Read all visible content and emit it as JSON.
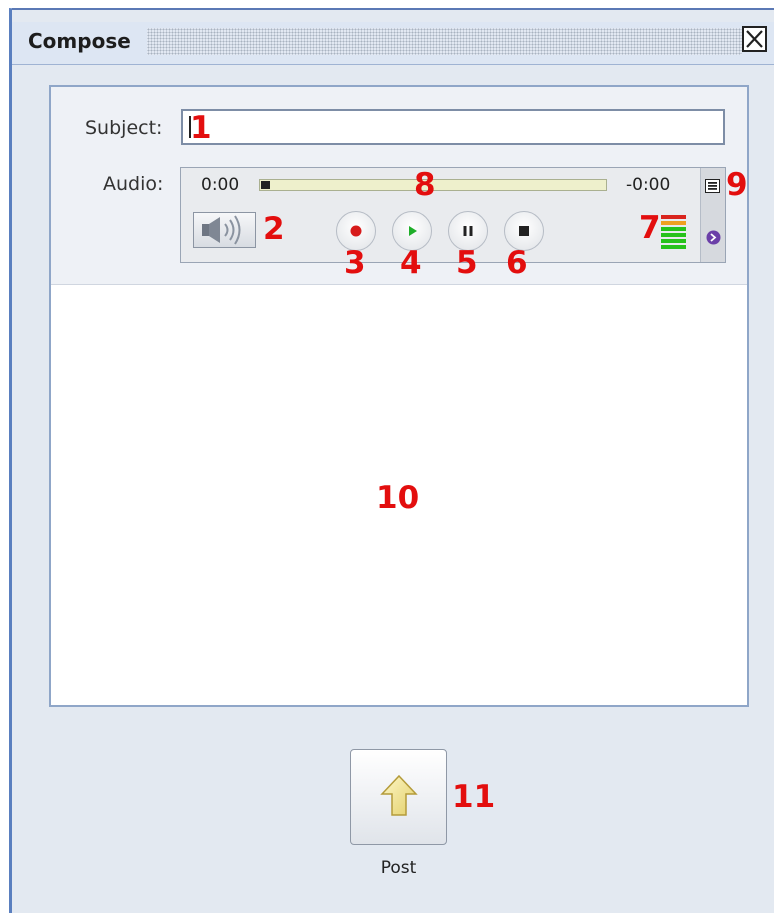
{
  "window": {
    "title": "Compose",
    "close_icon": "close-x-icon"
  },
  "form": {
    "subject_label": "Subject:",
    "subject_value": "",
    "audio_label": "Audio:"
  },
  "audio_player": {
    "elapsed": "0:00",
    "remaining": "-0:00",
    "progress": 0,
    "buttons": [
      "record",
      "play",
      "pause",
      "stop"
    ],
    "level_meter_colors": [
      "#d9241d",
      "#f0a020",
      "#27c21b"
    ]
  },
  "post_button": {
    "label": "Post",
    "icon": "up-arrow-icon"
  },
  "annotations": {
    "subject_field": "1",
    "volume_button": "2",
    "record_button": "3",
    "play_button": "4",
    "pause_button": "5",
    "stop_button": "6",
    "level_meter": "7",
    "progress_bar": "8",
    "menu": "9",
    "body_area": "10",
    "post": "11"
  }
}
